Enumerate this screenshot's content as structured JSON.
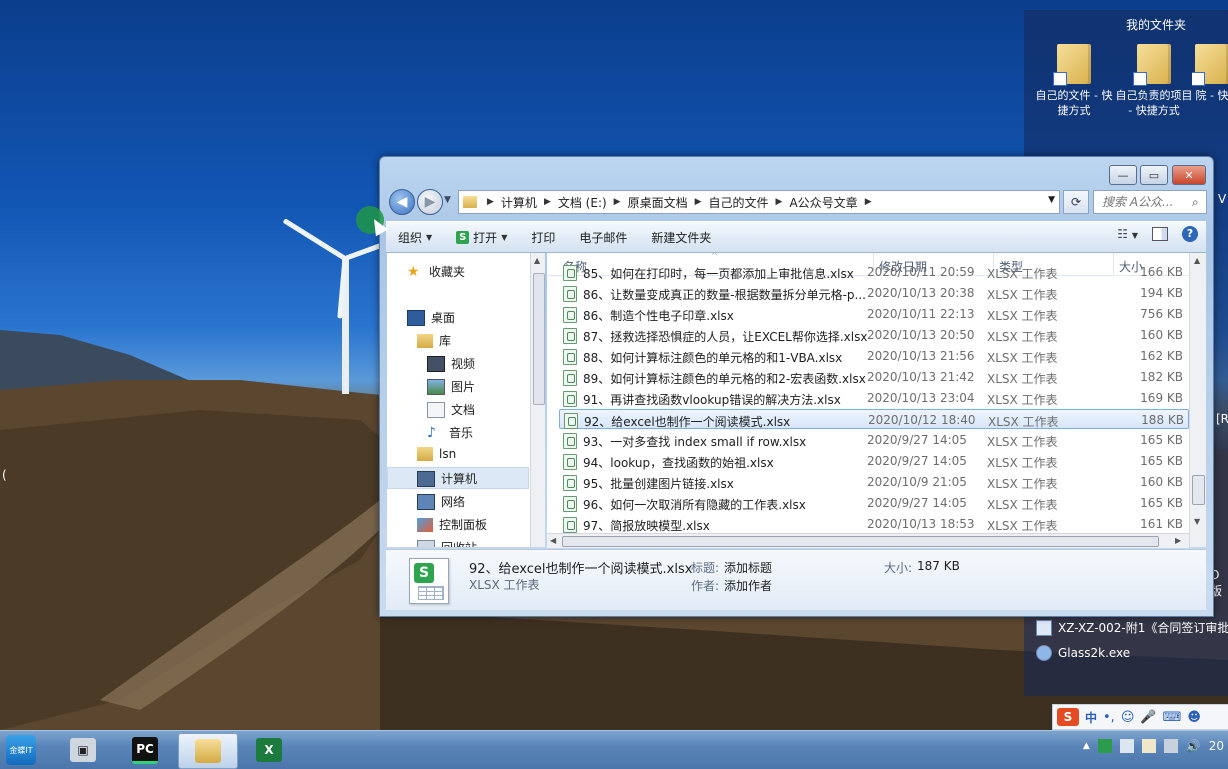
{
  "desktop": {
    "title": "我的文件夹",
    "icons": [
      {
        "label": "自己的文件 - 快捷方式"
      },
      {
        "label": "自己负责的项目 - 快捷方式"
      },
      {
        "label": "院 - 快"
      }
    ],
    "edge_text_right": "[R",
    "edge_text_right2": "O版",
    "edge_text_left": "(",
    "edge_text_v": "V",
    "files": [
      {
        "label": "XZ-XZ-002-附1《合同签订审批"
      },
      {
        "label": "Glass2k.exe"
      }
    ]
  },
  "window": {
    "controls": {
      "minimize": "—",
      "maximize": "▭",
      "close": "✕"
    },
    "address": {
      "crumbs": [
        "计算机",
        "文档 (E:)",
        "原桌面文档",
        "自己的文件",
        "A公众号文章"
      ]
    },
    "search": {
      "placeholder": "搜索 A公众..."
    },
    "toolbar": {
      "organize": "组织",
      "open": "打开",
      "print": "打印",
      "email": "电子邮件",
      "new_folder": "新建文件夹"
    },
    "nav": {
      "favorites": "收藏夹",
      "desktop": "桌面",
      "library": "库",
      "video": "视频",
      "pictures": "图片",
      "documents": "文档",
      "music": "音乐",
      "lsn": "lsn",
      "computer": "计算机",
      "network": "网络",
      "control_panel": "控制面板",
      "recycle": "回收站"
    },
    "columns": {
      "name": "名称",
      "modified": "修改日期",
      "type": "类型",
      "size": "大小"
    },
    "files": [
      {
        "name": "85、如何在打印时，每一页都添加上审批信息.xlsx",
        "date": "2020/10/11 20:59",
        "type": "XLSX 工作表",
        "size": "166 KB"
      },
      {
        "name": "86、让数量变成真正的数量-根据数量拆分单元格-p...",
        "date": "2020/10/13 20:38",
        "type": "XLSX 工作表",
        "size": "194 KB"
      },
      {
        "name": "86、制造个性电子印章.xlsx",
        "date": "2020/10/11 22:13",
        "type": "XLSX 工作表",
        "size": "756 KB"
      },
      {
        "name": "87、拯救选择恐惧症的人员，让EXCEL帮你选择.xlsx",
        "date": "2020/10/13 20:50",
        "type": "XLSX 工作表",
        "size": "160 KB"
      },
      {
        "name": "88、如何计算标注颜色的单元格的和1-VBA.xlsx",
        "date": "2020/10/13 21:56",
        "type": "XLSX 工作表",
        "size": "162 KB"
      },
      {
        "name": "89、如何计算标注颜色的单元格的和2-宏表函数.xlsx",
        "date": "2020/10/13 21:42",
        "type": "XLSX 工作表",
        "size": "182 KB"
      },
      {
        "name": "91、再讲查找函数vlookup错误的解决方法.xlsx",
        "date": "2020/10/13 23:04",
        "type": "XLSX 工作表",
        "size": "169 KB"
      },
      {
        "name": "92、给excel也制作一个阅读模式.xlsx",
        "date": "2020/10/12 18:40",
        "type": "XLSX 工作表",
        "size": "188 KB"
      },
      {
        "name": "93、一对多查找 index small if row.xlsx",
        "date": "2020/9/27 14:05",
        "type": "XLSX 工作表",
        "size": "165 KB"
      },
      {
        "name": "94、lookup，查找函数的始祖.xlsx",
        "date": "2020/9/27 14:05",
        "type": "XLSX 工作表",
        "size": "165 KB"
      },
      {
        "name": "95、批量创建图片链接.xlsx",
        "date": "2020/10/9 21:05",
        "type": "XLSX 工作表",
        "size": "160 KB"
      },
      {
        "name": "96、如何一次取消所有隐藏的工作表.xlsx",
        "date": "2020/9/27 14:05",
        "type": "XLSX 工作表",
        "size": "165 KB"
      },
      {
        "name": "97、简报放映模型.xlsx",
        "date": "2020/10/13 18:53",
        "type": "XLSX 工作表",
        "size": "161 KB"
      }
    ],
    "selected_index": 7,
    "details": {
      "filename": "92、给excel也制作一个阅读模式.xlsx",
      "filetype": "XLSX 工作表",
      "title_label": "标题:",
      "title_value": "添加标题",
      "author_label": "作者:",
      "author_value": "添加作者",
      "size_label": "大小:",
      "size_value": "187 KB"
    }
  },
  "ime": {
    "logo": "S",
    "mode": "中"
  },
  "taskbar": {
    "start_label": "金蝶IT",
    "apps": [
      {
        "name": "video-app",
        "label": "🎥"
      },
      {
        "name": "pycharm",
        "label": "PC"
      },
      {
        "name": "explorer",
        "label": ""
      },
      {
        "name": "excel",
        "label": "X"
      }
    ],
    "clock": "20"
  },
  "colors": {
    "accent": "#3a72c2",
    "excel_green": "#2ea44f",
    "selection": "#d6e7fb"
  }
}
